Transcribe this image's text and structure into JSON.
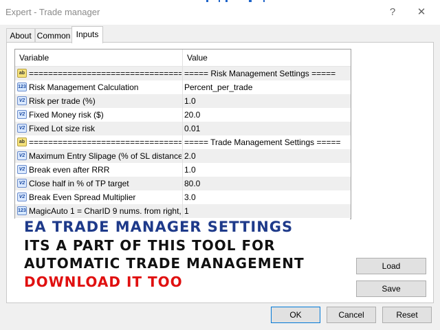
{
  "window": {
    "title": "Expert - Trade manager",
    "help_glyph": "?",
    "close_glyph": "✕"
  },
  "tabs": [
    {
      "label": "About"
    },
    {
      "label": "Common"
    },
    {
      "label": "Inputs"
    }
  ],
  "grid": {
    "headers": {
      "variable": "Variable",
      "value": "Value"
    },
    "rows": [
      {
        "icon": "ab",
        "variable": "================================",
        "value": "===== Risk Management Settings ====="
      },
      {
        "icon": "123",
        "variable": "Risk Management Calculation",
        "value": "Percent_per_trade"
      },
      {
        "icon": "v2",
        "variable": "Risk per trade (%)",
        "value": "1.0"
      },
      {
        "icon": "v2",
        "variable": "Fixed Money risk ($)",
        "value": "20.0"
      },
      {
        "icon": "v2",
        "variable": "Fixed Lot size risk",
        "value": "0.01"
      },
      {
        "icon": "ab",
        "variable": "================================",
        "value": "===== Trade Management Settings ====="
      },
      {
        "icon": "v2",
        "variable": "Maximum Entry Slipage (% of SL distance)",
        "value": "2.0"
      },
      {
        "icon": "v2",
        "variable": "Break even after RRR",
        "value": "1.0"
      },
      {
        "icon": "v2",
        "variable": "Close half in % of TP target",
        "value": "80.0"
      },
      {
        "icon": "v2",
        "variable": "Break Even Spread Multiplier",
        "value": "3.0"
      },
      {
        "icon": "123",
        "variable": "MagicAuto 1 = CharID 9 nums. from right, > ...",
        "value": "1"
      }
    ]
  },
  "overlay": {
    "line1": "EA Trade Manager Settings",
    "line2": "Its a part of this tool for",
    "line3": "automatic trade management",
    "line4": "Download it too"
  },
  "buttons": {
    "load": "Load",
    "save": "Save",
    "ok": "OK",
    "cancel": "Cancel",
    "reset": "Reset"
  },
  "colors": {
    "accent": "#0078d7",
    "overlay_blue": "#1e3a8a",
    "overlay_red": "#e01010"
  }
}
